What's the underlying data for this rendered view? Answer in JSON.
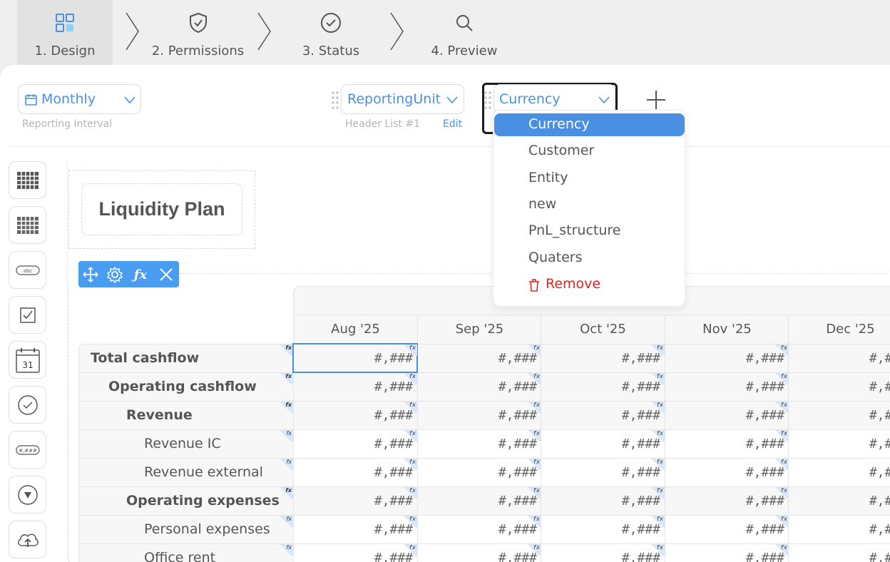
{
  "stepper": {
    "steps": [
      {
        "label": "1. Design",
        "icon": "grid-icon",
        "active": true
      },
      {
        "label": "2. Permissions",
        "icon": "shield-check-icon",
        "active": false
      },
      {
        "label": "3. Status",
        "icon": "circle-check-icon",
        "active": false
      },
      {
        "label": "4. Preview",
        "icon": "search-icon",
        "active": false
      }
    ]
  },
  "header": {
    "interval": {
      "value": "Monthly",
      "caption": "Reporting Interval"
    },
    "header_list": {
      "value": "ReportingUnit",
      "caption": "Header List #1",
      "edit": "Edit"
    },
    "dimension": {
      "value": "Currency"
    }
  },
  "dropdown": {
    "items": [
      "Currency",
      "Customer",
      "Entity",
      "new",
      "PnL_structure",
      "Quaters"
    ],
    "selected": "Currency",
    "remove": "Remove"
  },
  "toolbox": [
    "table-icon",
    "grid-table-icon",
    "text-field-icon",
    "checkbox-icon",
    "calendar-icon",
    "check-circle-icon",
    "number-field-icon",
    "dropdown-icon",
    "upload-icon"
  ],
  "toolbox_calendar_day": "31",
  "toolbox_text_sample": "abc",
  "toolbox_number_sample": "#,###",
  "report": {
    "title": "Liquidity Plan",
    "columns": [
      "Aug '25",
      "Sep '25",
      "Oct '25",
      "Nov '25",
      "Dec '25"
    ],
    "rows": [
      {
        "label": "Total cashflow",
        "bold": true
      },
      {
        "label": "Operating cashflow",
        "bold": true
      },
      {
        "label": "Revenue",
        "bold": true
      },
      {
        "label": "Revenue IC",
        "bold": false
      },
      {
        "label": "Revenue external",
        "bold": false
      },
      {
        "label": "Operating expenses",
        "bold": true
      },
      {
        "label": "Personal expenses",
        "bold": false
      },
      {
        "label": "Office rent",
        "bold": false
      }
    ],
    "cell_format": "#,###",
    "fx_marker": "fx"
  },
  "colors": {
    "accent": "#4a90e2",
    "remove": "#e02424",
    "toolbar": "#4a9cf0"
  }
}
